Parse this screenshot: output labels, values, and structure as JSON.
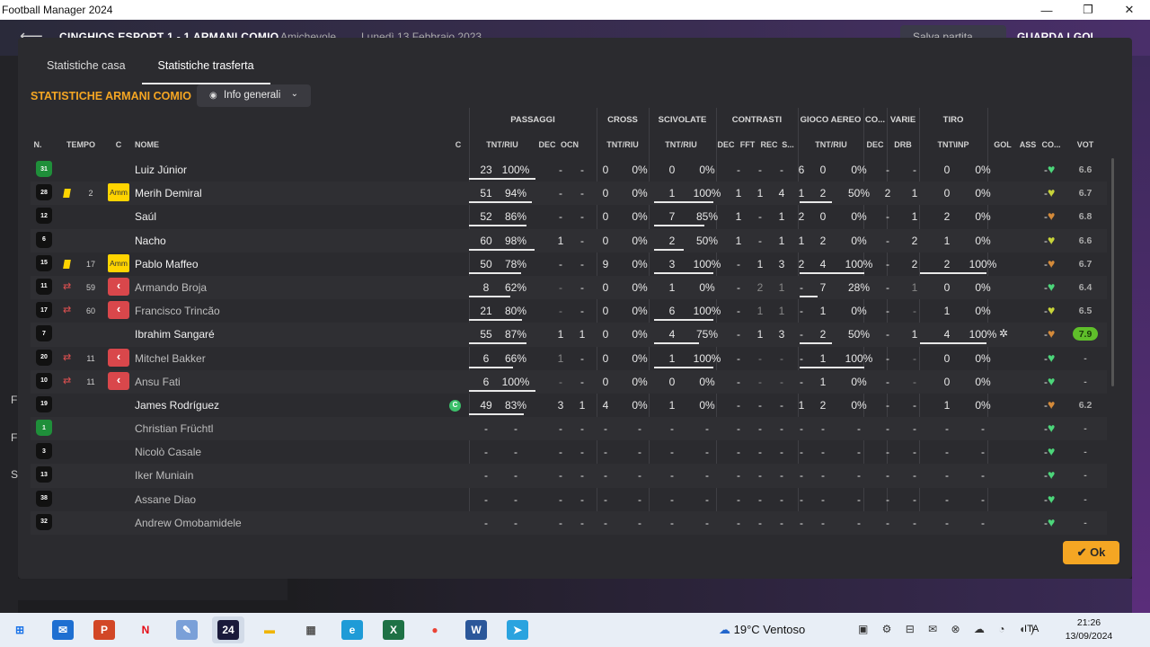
{
  "window": {
    "title": "Football Manager 2024",
    "min": "—",
    "max": "❐",
    "close": "✕"
  },
  "match_header": {
    "back": "⟵",
    "score_line": "CINGHIOS ESPORT  1 - 1  ARMANI COMIO",
    "competition": "Amichevole",
    "date": "Lunedì 13 Febbraio 2023",
    "save_label": "Salva partita",
    "watch_label": "GUARDA LGOL"
  },
  "bg_letters": [
    "F",
    "F",
    "S"
  ],
  "tabs": [
    {
      "label": "Statistiche casa"
    },
    {
      "label": "Statistiche trasferta"
    }
  ],
  "section_title": "STATISTICHE ARMANI COMIO",
  "view_dropdown": {
    "label": "Info generali"
  },
  "groups": {
    "passaggi": "PASSAGGI",
    "cross": "CROSS",
    "scivolate": "SCIVOLATE",
    "contrasti": "CONTRASTI",
    "gioco_aereo": "GIOCO AEREO",
    "co": "CO...",
    "varie": "VARIE",
    "tiro": "TIRO"
  },
  "headers": {
    "n": "N.",
    "tempo": "TEMPO",
    "c1": "C",
    "nome": "NOME",
    "c2": "C",
    "pass_tnt": "TNT/RIU",
    "pass_dec": "DEC",
    "pass_ocn": "OCN",
    "cross_tnt": "TNT/RIU",
    "sciv_tnt": "TNT/RIU",
    "con_dec": "DEC",
    "con_fft": "FFT",
    "con_rec": "REC",
    "con_s": "S...",
    "aereo_tnt": "TNT/RIU",
    "co_dec": "DEC",
    "varie_drb": "DRB",
    "tiro": "TNT\\INP",
    "gol": "GOL",
    "ass": "ASS",
    "cond": "CO...",
    "vot": "VOT"
  },
  "players": [
    {
      "num": "31",
      "gk": true,
      "name": "Luiz Júnior",
      "sub": false,
      "min": "",
      "card": "",
      "subout": false,
      "captain": false,
      "pass_t": "23",
      "pass_p": "100%",
      "dec": "-",
      "ocn": "-",
      "cr_t": "0",
      "cr_p": "0%",
      "sc_t": "0",
      "sc_p": "0%",
      "c_dec": "-",
      "c_fft": "-",
      "c_rec": "-",
      "c_s": "6",
      "ae_t": "0",
      "ae_p": "0%",
      "co_dec": "-",
      "drb": "-",
      "ti_t": "0",
      "ti_p": "0%",
      "gol": "",
      "ass": "-",
      "heart": "#4cd67a",
      "vot": "6.6",
      "best": false,
      "pass_frac": 1.0,
      "sc_frac": 0,
      "ae_frac": 0,
      "ti_frac": 0
    },
    {
      "num": "28",
      "gk": false,
      "name": "Merih Demiral",
      "sub": false,
      "min": "2",
      "card": "Amm",
      "subout": false,
      "captain": false,
      "pass_t": "51",
      "pass_p": "94%",
      "dec": "-",
      "ocn": "-",
      "cr_t": "0",
      "cr_p": "0%",
      "sc_t": "1",
      "sc_p": "100%",
      "c_dec": "1",
      "c_fft": "1",
      "c_rec": "4",
      "c_s": "1",
      "ae_t": "2",
      "ae_p": "50%",
      "co_dec": "2",
      "drb": "1",
      "ti_t": "0",
      "ti_p": "0%",
      "gol": "",
      "ass": "-",
      "heart": "#c8d43a",
      "vot": "6.7",
      "best": false,
      "pass_frac": 0.94,
      "sc_frac": 1.0,
      "ae_frac": 0.5,
      "ti_frac": 0
    },
    {
      "num": "12",
      "gk": false,
      "name": "Saúl",
      "sub": false,
      "min": "",
      "card": "",
      "subout": false,
      "captain": false,
      "pass_t": "52",
      "pass_p": "86%",
      "dec": "-",
      "ocn": "-",
      "cr_t": "0",
      "cr_p": "0%",
      "sc_t": "7",
      "sc_p": "85%",
      "c_dec": "1",
      "c_fft": "-",
      "c_rec": "1",
      "c_s": "2",
      "ae_t": "0",
      "ae_p": "0%",
      "co_dec": "-",
      "drb": "1",
      "ti_t": "2",
      "ti_p": "0%",
      "gol": "",
      "ass": "-",
      "heart": "#d48a3a",
      "vot": "6.8",
      "best": false,
      "pass_frac": 0.86,
      "sc_frac": 0.85,
      "ae_frac": 0,
      "ti_frac": 0
    },
    {
      "num": "6",
      "gk": false,
      "name": "Nacho",
      "sub": false,
      "min": "",
      "card": "",
      "subout": false,
      "captain": false,
      "pass_t": "60",
      "pass_p": "98%",
      "dec": "1",
      "ocn": "-",
      "cr_t": "0",
      "cr_p": "0%",
      "sc_t": "2",
      "sc_p": "50%",
      "c_dec": "1",
      "c_fft": "-",
      "c_rec": "1",
      "c_s": "1",
      "ae_t": "2",
      "ae_p": "0%",
      "co_dec": "-",
      "drb": "2",
      "ti_t": "1",
      "ti_p": "0%",
      "gol": "",
      "ass": "-",
      "heart": "#c8d43a",
      "vot": "6.6",
      "best": false,
      "pass_frac": 0.98,
      "sc_frac": 0.5,
      "ae_frac": 0,
      "ti_frac": 0
    },
    {
      "num": "15",
      "gk": false,
      "name": "Pablo Maffeo",
      "sub": false,
      "min": "17",
      "card": "Amm",
      "subout": false,
      "captain": false,
      "pass_t": "50",
      "pass_p": "78%",
      "dec": "-",
      "ocn": "-",
      "cr_t": "9",
      "cr_p": "0%",
      "sc_t": "3",
      "sc_p": "100%",
      "c_dec": "-",
      "c_fft": "1",
      "c_rec": "3",
      "c_s": "2",
      "ae_t": "4",
      "ae_p": "100%",
      "co_dec": "-",
      "drb": "2",
      "ti_t": "2",
      "ti_p": "100%",
      "gol": "",
      "ass": "-",
      "heart": "#d48a3a",
      "vot": "6.7",
      "best": false,
      "pass_frac": 0.78,
      "sc_frac": 1.0,
      "ae_frac": 1.0,
      "ti_frac": 1.0
    },
    {
      "num": "11",
      "gk": false,
      "name": "Armando Broja",
      "sub": true,
      "min": "59",
      "card": "",
      "subout": true,
      "captain": false,
      "pass_t": "8",
      "pass_p": "62%",
      "dec": "-",
      "ocn": "-",
      "cr_t": "0",
      "cr_p": "0%",
      "sc_t": "1",
      "sc_p": "0%",
      "c_dec": "-",
      "c_fft": "2",
      "c_rec": "1",
      "c_s": "-",
      "ae_t": "7",
      "ae_p": "28%",
      "co_dec": "-",
      "drb": "1",
      "ti_t": "0",
      "ti_p": "0%",
      "gol": "",
      "ass": "-",
      "heart": "#4cd67a",
      "vot": "6.4",
      "best": false,
      "pass_frac": 0.62,
      "sc_frac": 0,
      "ae_frac": 0.28,
      "ti_frac": 0
    },
    {
      "num": "17",
      "gk": false,
      "name": "Francisco Trincão",
      "sub": true,
      "min": "60",
      "card": "",
      "subout": true,
      "captain": false,
      "pass_t": "21",
      "pass_p": "80%",
      "dec": "-",
      "ocn": "-",
      "cr_t": "0",
      "cr_p": "0%",
      "sc_t": "6",
      "sc_p": "100%",
      "c_dec": "-",
      "c_fft": "1",
      "c_rec": "1",
      "c_s": "-",
      "ae_t": "1",
      "ae_p": "0%",
      "co_dec": "-",
      "drb": "-",
      "ti_t": "1",
      "ti_p": "0%",
      "gol": "",
      "ass": "-",
      "heart": "#c8d43a",
      "vot": "6.5",
      "best": false,
      "pass_frac": 0.8,
      "sc_frac": 1.0,
      "ae_frac": 0,
      "ti_frac": 0
    },
    {
      "num": "7",
      "gk": false,
      "name": "Ibrahim Sangaré",
      "sub": false,
      "min": "",
      "card": "",
      "subout": false,
      "captain": false,
      "pass_t": "55",
      "pass_p": "87%",
      "dec": "1",
      "ocn": "1",
      "cr_t": "0",
      "cr_p": "0%",
      "sc_t": "4",
      "sc_p": "75%",
      "c_dec": "-",
      "c_fft": "1",
      "c_rec": "3",
      "c_s": "-",
      "ae_t": "2",
      "ae_p": "50%",
      "co_dec": "-",
      "drb": "1",
      "ti_t": "4",
      "ti_p": "100%",
      "gol": "✲",
      "ass": "-",
      "heart": "#d48a3a",
      "vot": "7.9",
      "best": true,
      "pass_frac": 0.87,
      "sc_frac": 0.75,
      "ae_frac": 0.5,
      "ti_frac": 1.0
    },
    {
      "num": "20",
      "gk": false,
      "name": "Mitchel Bakker",
      "sub": true,
      "min": "11",
      "card": "",
      "subout": true,
      "captain": false,
      "pass_t": "6",
      "pass_p": "66%",
      "dec": "1",
      "ocn": "-",
      "cr_t": "0",
      "cr_p": "0%",
      "sc_t": "1",
      "sc_p": "100%",
      "c_dec": "-",
      "c_fft": "-",
      "c_rec": "-",
      "c_s": "-",
      "ae_t": "1",
      "ae_p": "100%",
      "co_dec": "-",
      "drb": "-",
      "ti_t": "0",
      "ti_p": "0%",
      "gol": "",
      "ass": "-",
      "heart": "#4cd67a",
      "vot": "-",
      "best": false,
      "pass_frac": 0.66,
      "sc_frac": 1.0,
      "ae_frac": 1.0,
      "ti_frac": 0
    },
    {
      "num": "10",
      "gk": false,
      "name": "Ansu Fati",
      "sub": true,
      "min": "11",
      "card": "",
      "subout": true,
      "captain": false,
      "pass_t": "6",
      "pass_p": "100%",
      "dec": "-",
      "ocn": "-",
      "cr_t": "0",
      "cr_p": "0%",
      "sc_t": "0",
      "sc_p": "0%",
      "c_dec": "-",
      "c_fft": "-",
      "c_rec": "-",
      "c_s": "-",
      "ae_t": "1",
      "ae_p": "0%",
      "co_dec": "-",
      "drb": "-",
      "ti_t": "0",
      "ti_p": "0%",
      "gol": "",
      "ass": "-",
      "heart": "#4cd67a",
      "vot": "-",
      "best": false,
      "pass_frac": 1.0,
      "sc_frac": 0,
      "ae_frac": 0,
      "ti_frac": 0
    },
    {
      "num": "19",
      "gk": false,
      "name": "James Rodríguez",
      "sub": false,
      "min": "",
      "card": "",
      "subout": false,
      "captain": true,
      "captain_label": "C",
      "pass_t": "49",
      "pass_p": "83%",
      "dec": "3",
      "ocn": "1",
      "cr_t": "4",
      "cr_p": "0%",
      "sc_t": "1",
      "sc_p": "0%",
      "c_dec": "-",
      "c_fft": "-",
      "c_rec": "-",
      "c_s": "1",
      "ae_t": "2",
      "ae_p": "0%",
      "co_dec": "-",
      "drb": "-",
      "ti_t": "1",
      "ti_p": "0%",
      "gol": "",
      "ass": "-",
      "heart": "#d48a3a",
      "vot": "6.2",
      "best": false,
      "pass_frac": 0.83,
      "sc_frac": 0,
      "ae_frac": 0,
      "ti_frac": 0
    },
    {
      "num": "1",
      "gk": true,
      "name": "Christian Früchtl",
      "sub": true,
      "bench": true,
      "heart": "#4cd67a",
      "vot": "-"
    },
    {
      "num": "3",
      "gk": false,
      "name": "Nicolò Casale",
      "sub": true,
      "bench": true,
      "heart": "#4cd67a",
      "vot": "-"
    },
    {
      "num": "13",
      "gk": false,
      "name": "Iker Muniain",
      "sub": true,
      "bench": true,
      "heart": "#4cd67a",
      "vot": "-"
    },
    {
      "num": "38",
      "gk": false,
      "name": "Assane Diao",
      "sub": true,
      "bench": true,
      "heart": "#4cd67a",
      "vot": "-"
    },
    {
      "num": "32",
      "gk": false,
      "name": "Andrew Omobamidele",
      "sub": true,
      "bench": true,
      "heart": "#4cd67a",
      "vot": "-"
    }
  ],
  "ok_label": "✔ Ok",
  "taskbar": {
    "icons": [
      {
        "name": "windows-start-icon",
        "glyph": "⊞",
        "color": "#1a73e8",
        "bg": "transparent"
      },
      {
        "name": "mail-icon",
        "glyph": "✉",
        "color": "#fff",
        "bg": "#1e6fd1"
      },
      {
        "name": "powerpoint-icon",
        "glyph": "P",
        "color": "#fff",
        "bg": "#d24726"
      },
      {
        "name": "netflix-icon",
        "glyph": "N",
        "color": "#e50914",
        "bg": "transparent"
      },
      {
        "name": "paint-icon",
        "glyph": "✎",
        "color": "#fff",
        "bg": "#7aa0d8"
      },
      {
        "name": "fm24-icon",
        "glyph": "24",
        "color": "#fff",
        "bg": "#1a1a3a"
      },
      {
        "name": "file-explorer-icon",
        "glyph": "▬",
        "color": "#f0b400",
        "bg": "transparent"
      },
      {
        "name": "calculator-icon",
        "glyph": "▦",
        "color": "#555",
        "bg": "transparent"
      },
      {
        "name": "edge-icon",
        "glyph": "e",
        "color": "#fff",
        "bg": "#1f9bd7"
      },
      {
        "name": "excel-icon",
        "glyph": "X",
        "color": "#fff",
        "bg": "#1e7145"
      },
      {
        "name": "chrome-icon",
        "glyph": "●",
        "color": "#ea4335",
        "bg": "transparent"
      },
      {
        "name": "word-icon",
        "glyph": "W",
        "color": "#fff",
        "bg": "#2b579a"
      },
      {
        "name": "telegram-icon",
        "glyph": "➤",
        "color": "#fff",
        "bg": "#2aa3df"
      }
    ],
    "weather": "19°C  Ventoso",
    "tray": "▣ ⚙ ⊟ ✉ ⊗ ☁ ◔ ◖)",
    "lang": "ITA",
    "time": "21:26",
    "date": "13/09/2024"
  }
}
